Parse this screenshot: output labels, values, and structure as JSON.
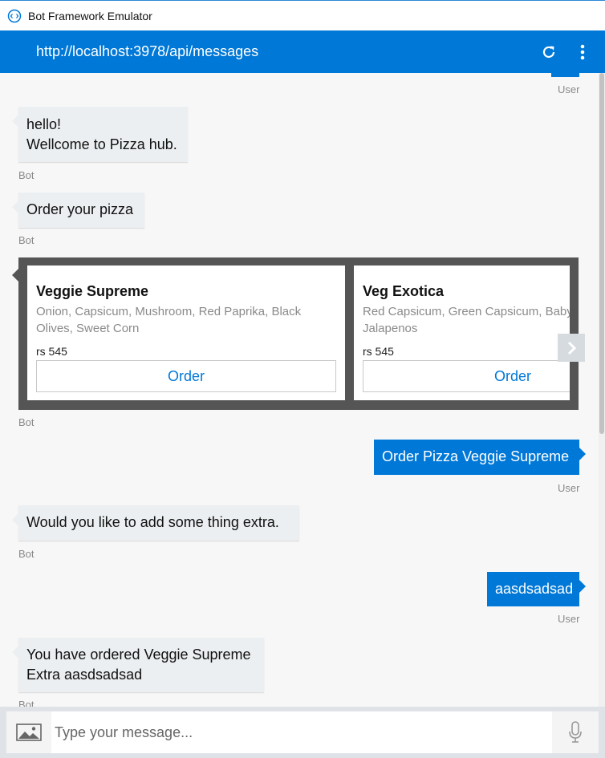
{
  "window": {
    "title": "Bot Framework Emulator"
  },
  "address": {
    "url": "http://localhost:3978/api/messages"
  },
  "messages": {
    "top_user_label": "User",
    "m1": {
      "line1": "hello!",
      "line2": "Wellcome to Pizza hub.",
      "sender": "Bot"
    },
    "m2": {
      "text": "Order your pizza",
      "sender": "Bot"
    },
    "carousel": {
      "sender": "Bot",
      "cards": [
        {
          "title": "Veggie Supreme",
          "subtitle": "Onion, Capsicum, Mushroom, Red Paprika, Black Olives, Sweet Corn",
          "price": "rs 545",
          "button": "Order"
        },
        {
          "title": "Veg Exotica",
          "subtitle": "Red Capsicum, Green Capsicum, Baby Corn, Olives, Jalapenos",
          "price": "rs 545",
          "button": "Order"
        }
      ]
    },
    "m3": {
      "text": "Order Pizza Veggie Supreme",
      "sender": "User"
    },
    "m4": {
      "text": "Would you like to add some thing extra.",
      "sender": "Bot"
    },
    "m5": {
      "text": "aasdsadsad",
      "sender": "User"
    },
    "m6": {
      "line1": "You have ordered Veggie Supreme",
      "line2": "Extra aasdsadsad",
      "sender": "Bot"
    }
  },
  "input": {
    "placeholder": "Type your message..."
  },
  "colors": {
    "accent": "#0078d7",
    "bot_bubble": "#eceff1",
    "carousel_bg": "#555555"
  }
}
